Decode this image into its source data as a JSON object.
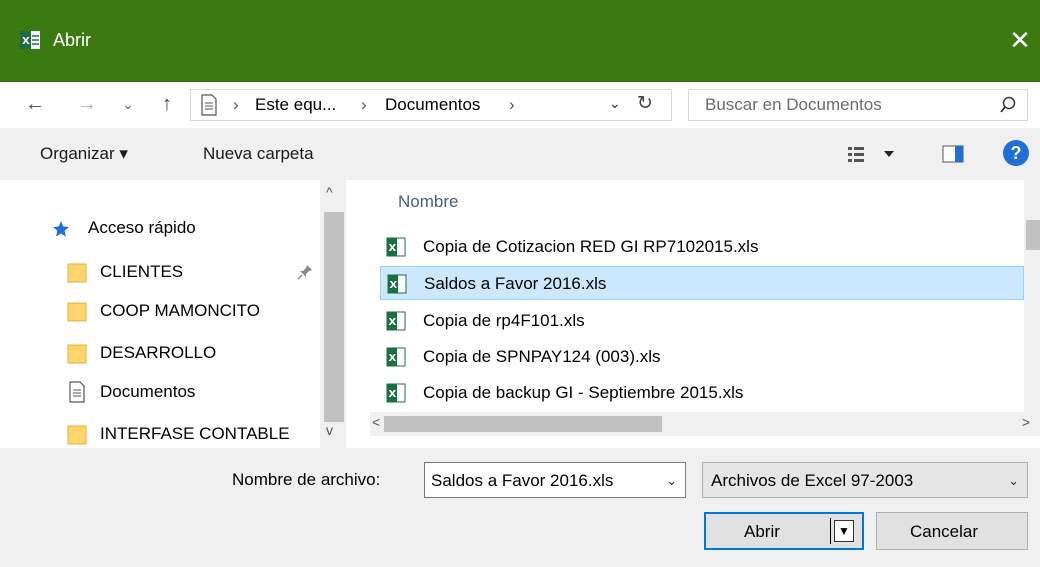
{
  "window": {
    "title": "Abrir",
    "close_glyph": "✕"
  },
  "navigation": {
    "back_glyph": "←",
    "forward_glyph": "→",
    "recent_glyph": "⌄",
    "up_glyph": "↑",
    "breadcrumbs": [
      "Este equ...",
      "Documentos"
    ],
    "sep_glyph": "›",
    "dropdown_glyph": "⌄",
    "refresh_glyph": "↻",
    "search_placeholder": "Buscar en Documentos"
  },
  "toolbar": {
    "organize_label": "Organizar ▾",
    "new_folder_label": "Nueva carpeta",
    "help_glyph": "?"
  },
  "sidebar": {
    "quick_access": "Acceso rápido",
    "items": [
      {
        "label": "CLIENTES",
        "icon": "folder-icon",
        "pinned": true
      },
      {
        "label": "COOP MAMONCITO",
        "icon": "folder-icon"
      },
      {
        "label": "DESARROLLO",
        "icon": "folder-icon"
      },
      {
        "label": "Documentos",
        "icon": "document-icon"
      },
      {
        "label": "INTERFASE CONTABLE",
        "icon": "folder-icon"
      }
    ],
    "scroll_up": "^",
    "scroll_down": "v"
  },
  "files": {
    "column_name": "Nombre",
    "rows": [
      {
        "name": "Copia de Cotizacion RED GI RP7102015.xls",
        "selected": false
      },
      {
        "name": "Saldos a Favor 2016.xls",
        "selected": true
      },
      {
        "name": "Copia de rp4F101.xls",
        "selected": false
      },
      {
        "name": "Copia de SPNPAY124 (003).xls",
        "selected": false
      },
      {
        "name": "Copia de backup GI - Septiembre 2015.xls",
        "selected": false
      }
    ],
    "scroll_left": "<",
    "scroll_right": ">"
  },
  "footer": {
    "filename_label": "Nombre de archivo:",
    "filename_value": "Saldos a Favor 2016.xls",
    "filetype_value": "Archivos de Excel 97-2003",
    "dropdown_glyph": "⌄",
    "open_label": "Abrir",
    "cancel_label": "Cancelar"
  },
  "colors": {
    "titlebar": "#3a7a10",
    "selection": "#cce8ff",
    "accent": "#0078d7"
  }
}
